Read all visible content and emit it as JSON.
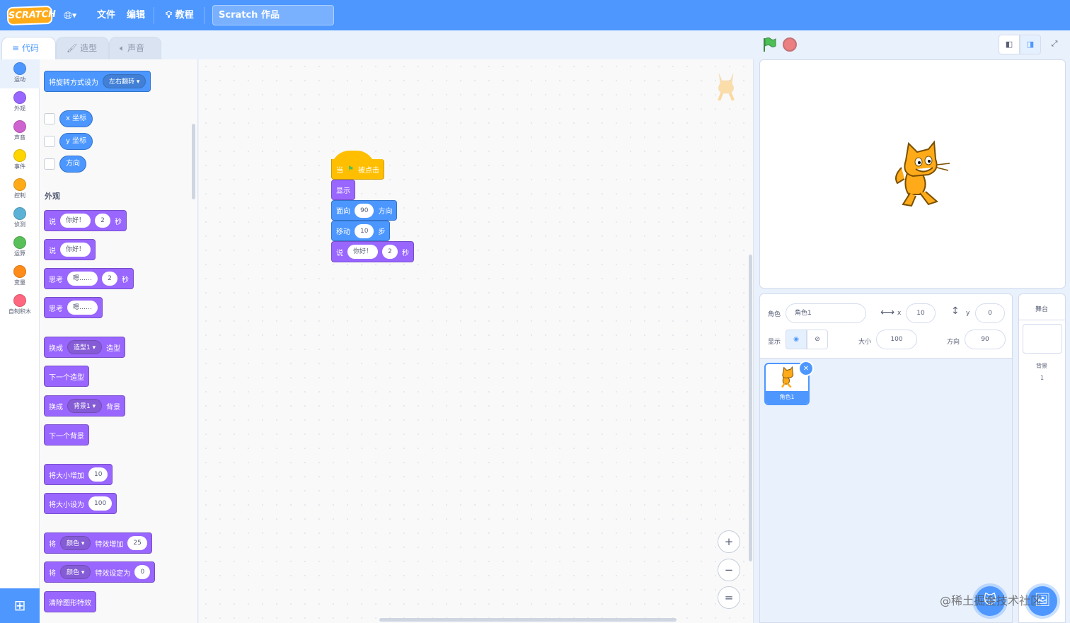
{
  "menubar": {
    "logo": "SCRATCH",
    "file": "文件",
    "edit": "编辑",
    "tutorials": "教程",
    "project_title": "Scratch 作品"
  },
  "tabs": {
    "code": "代码",
    "costumes": "造型",
    "sounds": "声音"
  },
  "categories": [
    {
      "label": "运动",
      "color": "#4c97ff"
    },
    {
      "label": "外观",
      "color": "#9966ff"
    },
    {
      "label": "声音",
      "color": "#cf63cf"
    },
    {
      "label": "事件",
      "color": "#ffd500"
    },
    {
      "label": "控制",
      "color": "#ffab19"
    },
    {
      "label": "侦测",
      "color": "#5cb1d6"
    },
    {
      "label": "运算",
      "color": "#59c059"
    },
    {
      "label": "变量",
      "color": "#ff8c1a"
    },
    {
      "label": "自制积木",
      "color": "#ff6680"
    }
  ],
  "palette": {
    "rotation": {
      "label": "将旋转方式设为",
      "value": "左右翻转"
    },
    "x_pos": "x 坐标",
    "y_pos": "y 坐标",
    "direction": "方向",
    "looks_heading": "外观",
    "say_secs": {
      "a": "说",
      "b": "你好！",
      "c": "2",
      "d": "秒"
    },
    "say": {
      "a": "说",
      "b": "你好！"
    },
    "think_secs": {
      "a": "思考",
      "b": "嗯……",
      "c": "2",
      "d": "秒"
    },
    "think": {
      "a": "思考",
      "b": "嗯……"
    },
    "switch_costume": {
      "a": "换成",
      "b": "造型1",
      "c": "造型"
    },
    "next_costume": "下一个造型",
    "switch_backdrop": {
      "a": "换成",
      "b": "背景1",
      "c": "背景"
    },
    "next_backdrop": "下一个背景",
    "change_size": {
      "a": "将大小增加",
      "b": "10"
    },
    "set_size": {
      "a": "将大小设为",
      "b": "100"
    },
    "change_effect": {
      "a": "将",
      "b": "颜色",
      "c": "特效增加",
      "d": "25"
    },
    "set_effect": {
      "a": "将",
      "b": "颜色",
      "c": "特效设定为",
      "d": "0"
    },
    "clear_effects": "清除图形特效"
  },
  "script": {
    "hat": {
      "a": "当",
      "b": "被点击"
    },
    "show": "显示",
    "point": {
      "a": "面向",
      "b": "90",
      "c": "方向"
    },
    "move": {
      "a": "移动",
      "b": "10",
      "c": "步"
    },
    "say": {
      "a": "说",
      "b": "你好！",
      "c": "2",
      "d": "秒"
    }
  },
  "zoom": {
    "in": "+",
    "out": "−",
    "reset": "="
  },
  "sprite_info": {
    "sprite_label": "角色",
    "sprite_name": "角色1",
    "x_label": "x",
    "x": "10",
    "y_label": "y",
    "y": "0",
    "show_label": "显示",
    "size_label": "大小",
    "size": "100",
    "direction_label": "方向",
    "direction": "90"
  },
  "sprite_tile": {
    "name": "角色1"
  },
  "stage_pane": {
    "title": "舞台",
    "backdrops_label": "背景",
    "backdrops_count": "1"
  },
  "watermark": "@稀土掘金技术社区"
}
